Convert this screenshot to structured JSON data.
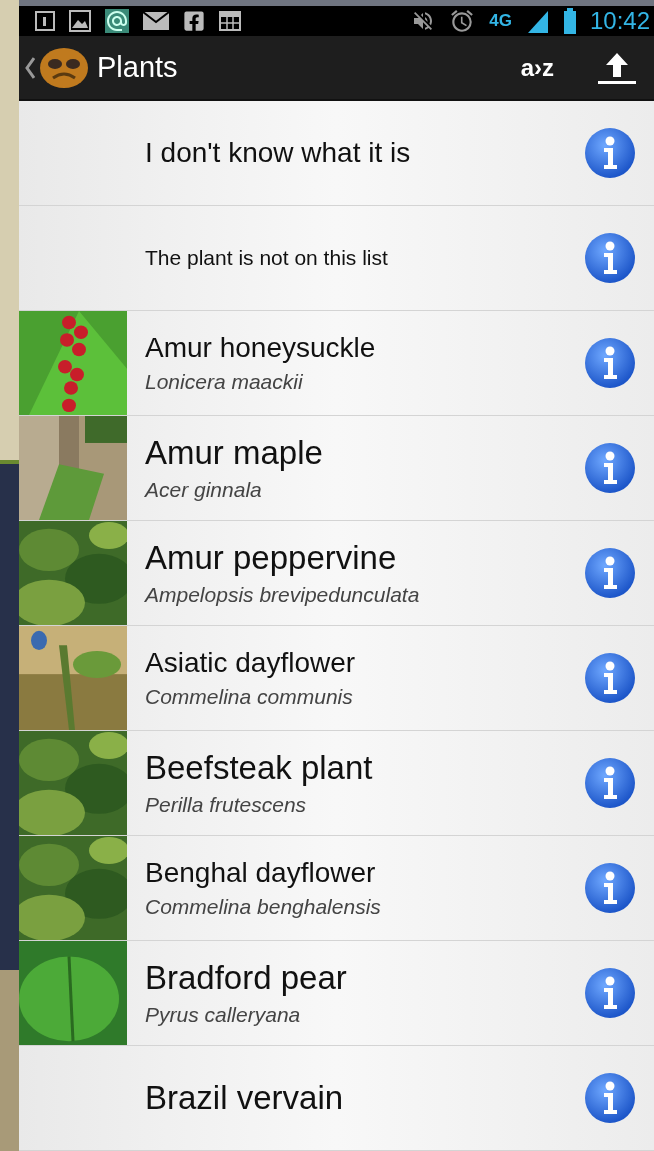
{
  "status_bar": {
    "network": "4G",
    "time": "10:42"
  },
  "action_bar": {
    "title": "Plants",
    "sort_label": "a›z"
  },
  "list": [
    {
      "kind": "prompt",
      "name": "I don't know what it is"
    },
    {
      "kind": "note",
      "name": "The plant is not on this list"
    },
    {
      "kind": "plant",
      "name": "Amur honeysuckle",
      "scientific": "Lonicera maackii"
    },
    {
      "kind": "plant",
      "name": "Amur maple",
      "scientific": "Acer ginnala"
    },
    {
      "kind": "plant",
      "name": "Amur peppervine",
      "scientific": "Ampelopsis brevipedunculata"
    },
    {
      "kind": "plant",
      "name": "Asiatic dayflower",
      "scientific": "Commelina communis"
    },
    {
      "kind": "plant",
      "name": "Beefsteak plant",
      "scientific": "Perilla frutescens"
    },
    {
      "kind": "plant",
      "name": "Benghal dayflower",
      "scientific": "Commelina benghalensis"
    },
    {
      "kind": "plant",
      "name": "Bradford pear",
      "scientific": "Pyrus calleryana"
    },
    {
      "kind": "plant",
      "name": "Brazil vervain"
    }
  ]
}
